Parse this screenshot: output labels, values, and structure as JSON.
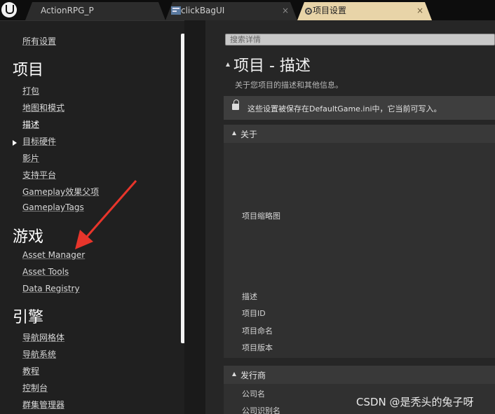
{
  "tabs": [
    {
      "label": "ActionRPG_P",
      "close": ""
    },
    {
      "label": "clickBagUI",
      "close": "×"
    },
    {
      "label": "项目设置",
      "close": "×"
    }
  ],
  "sidebar": {
    "all_settings": "所有设置",
    "sections": [
      {
        "title": "项目",
        "items": [
          "打包",
          "地图和模式",
          "描述",
          "目标硬件",
          "影片",
          "支持平台",
          "Gameplay效果父项",
          "GameplayTags"
        ]
      },
      {
        "title": "游戏",
        "items": [
          "Asset Manager",
          "Asset Tools",
          "Data Registry"
        ]
      },
      {
        "title": "引擎",
        "items": [
          "导航网格体",
          "导航系统",
          "教程",
          "控制台",
          "群集管理器"
        ]
      }
    ],
    "selected_item": "描述"
  },
  "main": {
    "search_placeholder": "搜索详情",
    "title": "项目 - 描述",
    "subtitle": "关于您项目的描述和其他信息。",
    "notice": "这些设置被保存在DefaultGame.ini中，它当前可写入。",
    "sections": [
      {
        "label": "关于",
        "props": [
          "项目缩略图",
          "描述",
          "项目ID",
          "项目命名",
          "项目版本"
        ]
      },
      {
        "label": "发行商",
        "props": [
          "公司名",
          "公司识别名"
        ]
      }
    ]
  },
  "watermark": "CSDN @是秃头的兔子呀",
  "colors": {
    "active_tab": "#e8d4a8",
    "annotation_arrow": "#e8352b",
    "background": "#202020"
  }
}
